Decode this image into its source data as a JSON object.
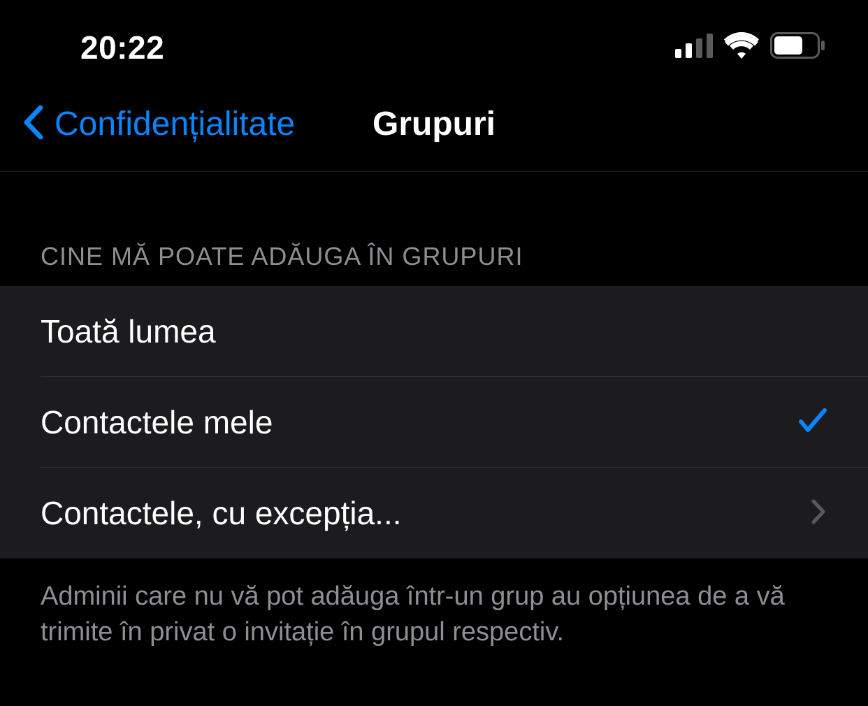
{
  "statusBar": {
    "time": "20:22"
  },
  "navBar": {
    "backLabel": "Confidențialitate",
    "title": "Grupuri"
  },
  "section": {
    "header": "CINE MĂ POATE ADĂUGA ÎN GRUPURI",
    "options": {
      "everyone": {
        "label": "Toată lumea",
        "selected": false,
        "hasChevron": false
      },
      "myContacts": {
        "label": "Contactele mele",
        "selected": true,
        "hasChevron": false
      },
      "contactsExcept": {
        "label": "Contactele, cu excepția...",
        "selected": false,
        "hasChevron": true
      }
    },
    "footer": "Adminii care nu vă pot adăuga într-un grup au opțiunea de a vă trimite în privat o invitație în grupul respectiv."
  },
  "colors": {
    "accent": "#0a84ff",
    "background": "#000000",
    "cellBackground": "#1c1c1e",
    "secondaryText": "#8e8e93",
    "primaryText": "#ffffff"
  }
}
